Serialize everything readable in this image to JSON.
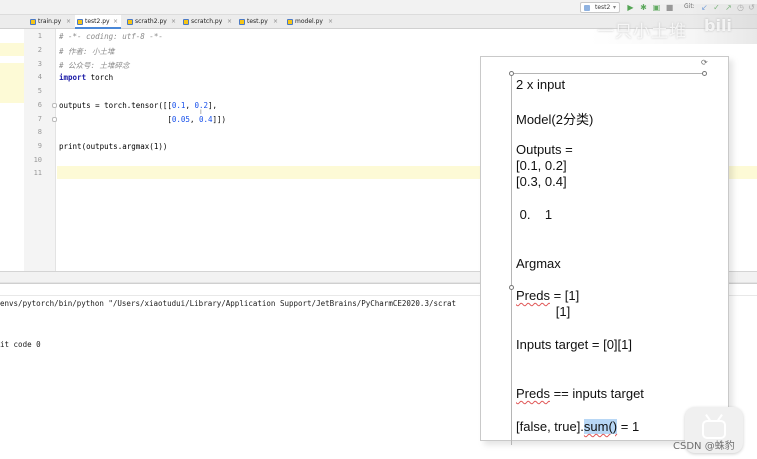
{
  "toolbar": {
    "run_config": "test2",
    "git_label": "Git:",
    "icons": [
      "run-icon",
      "debug-icon",
      "coverage-icon",
      "profile-icon",
      "stop-icon",
      "git-update-icon",
      "git-commit-icon",
      "git-push-icon",
      "history-icon",
      "rollback-icon"
    ]
  },
  "tabs": [
    {
      "label": "train.py",
      "active": false
    },
    {
      "label": "test2.py",
      "active": true
    },
    {
      "label": "scrath2.py",
      "active": false
    },
    {
      "label": "scratch.py",
      "active": false
    },
    {
      "label": "test.py",
      "active": false
    },
    {
      "label": "model.py",
      "active": false
    }
  ],
  "editor": {
    "line_numbers": [
      "1",
      "2",
      "3",
      "4",
      "5",
      "6",
      "7",
      "8",
      "9",
      "10",
      "11"
    ],
    "lines": {
      "l1": "# -*- coding: utf-8 -*-",
      "l2": "# 作者: 小土堆",
      "l3": "# 公众号: 土堆碎念",
      "l4_kw": "import",
      "l4_rest": " torch",
      "l6_a": "outputs = torch.tensor([[",
      "l6_n1": "0.1",
      "l6_b": ", ",
      "l6_n2": "0.2",
      "l6_c": "],",
      "l7_pad": "                        [",
      "l7_n1": "0.05",
      "l7_b": ", ",
      "l7_n2": "0.4",
      "l7_c": "]])",
      "l9": "print(outputs.argmax(1))"
    }
  },
  "console": {
    "command": "envs/pytorch/bin/python \"/Users/xiaotudui/Library/Application Support/JetBrains/PyCharmCE2020.3/scrat",
    "exit": "it code 0"
  },
  "watermark": {
    "text": "一只小土堆",
    "logo": "bili"
  },
  "notes": {
    "t1": "2 x input",
    "t2": "Model(2分类)",
    "t3": "Outputs =",
    "t4": "[0.1, 0.2]",
    "t5": "[0.3, 0.4]",
    "t6": " 0.    1",
    "t7": "Argmax",
    "t8_sq": "Preds",
    "t8_rest": " = [1]",
    "t9": "           [1]",
    "t10": "Inputs target = [0][1]",
    "t11_sq": "Preds",
    "t11_rest": " == inputs target",
    "t12_a": "[false, true].",
    "t12_sum": "sum()",
    "t12_b": " = 1"
  },
  "credit": "CSDN @蛛豹"
}
